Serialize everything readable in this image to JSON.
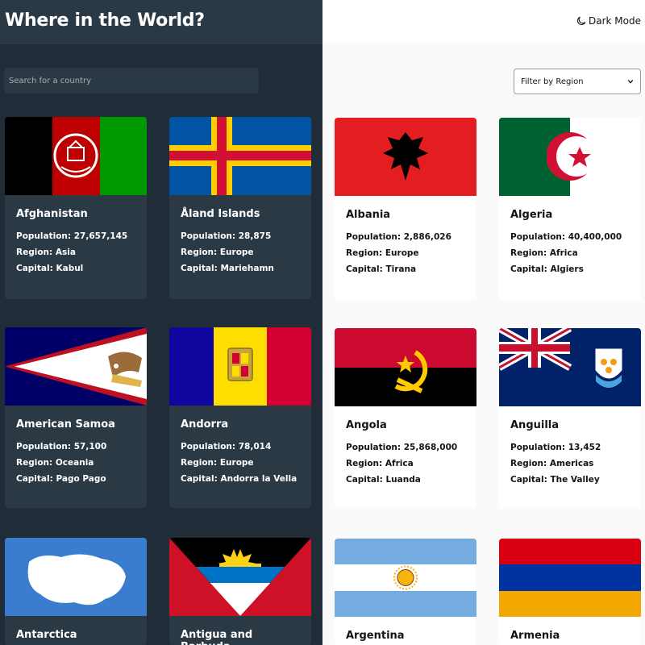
{
  "header": {
    "title": "Where in the World?",
    "theme_toggle_label": "Dark Mode",
    "theme_icon": "moon-icon"
  },
  "search": {
    "placeholder": "Search for a country",
    "icon": "none"
  },
  "filter": {
    "label": "Filter by Region",
    "icon": "chevron-down-icon"
  },
  "labels": {
    "population": "Population:",
    "region": "Region:",
    "capital": "Capital:"
  },
  "countries": [
    {
      "name": "Afghanistan",
      "population": "27,657,145",
      "region": "Asia",
      "capital": "Kabul"
    },
    {
      "name": "Åland Islands",
      "population": "28,875",
      "region": "Europe",
      "capital": "Mariehamn"
    },
    {
      "name": "Albania",
      "population": "2,886,026",
      "region": "Europe",
      "capital": "Tirana"
    },
    {
      "name": "Algeria",
      "population": "40,400,000",
      "region": "Africa",
      "capital": "Algiers"
    },
    {
      "name": "American Samoa",
      "population": "57,100",
      "region": "Oceania",
      "capital": "Pago Pago"
    },
    {
      "name": "Andorra",
      "population": "78,014",
      "region": "Europe",
      "capital": "Andorra la Vella"
    },
    {
      "name": "Angola",
      "population": "25,868,000",
      "region": "Africa",
      "capital": "Luanda"
    },
    {
      "name": "Anguilla",
      "population": "13,452",
      "region": "Americas",
      "capital": "The Valley"
    },
    {
      "name": "Antarctica"
    },
    {
      "name": "Antigua and Barbuda"
    },
    {
      "name": "Argentina"
    },
    {
      "name": "Armenia"
    }
  ],
  "colors": {
    "dark_bg": "#202c37",
    "dark_element": "#2b3945",
    "light_bg": "#fafafa",
    "light_element": "#ffffff",
    "light_text": "#111517"
  }
}
